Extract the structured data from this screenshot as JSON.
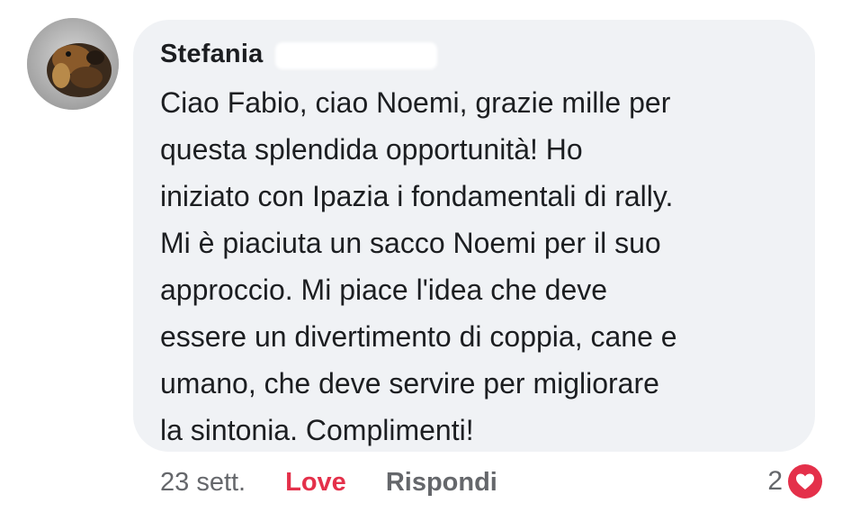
{
  "comment": {
    "author": "Stefania",
    "text": "Ciao Fabio, ciao Noemi, grazie mille per\nquesta splendida opportunità! Ho\niniziato con Ipazia i fondamentali di rally.\nMi è piaciuta un sacco Noemi per il suo\napproccio. Mi piace l'idea che deve\nessere un divertimento di coppia, cane e\numano, che deve servire per migliorare\nla sintonia. Complimenti!",
    "timestamp": "23 sett.",
    "love_label": "Love",
    "reply_label": "Rispondi",
    "reaction_count": "2",
    "reaction_icon": "heart-icon"
  },
  "colors": {
    "bubble_bg": "#f0f2f5",
    "love_red": "#e4304a",
    "meta_gray": "#65676b",
    "text_dark": "#1c1e21"
  }
}
